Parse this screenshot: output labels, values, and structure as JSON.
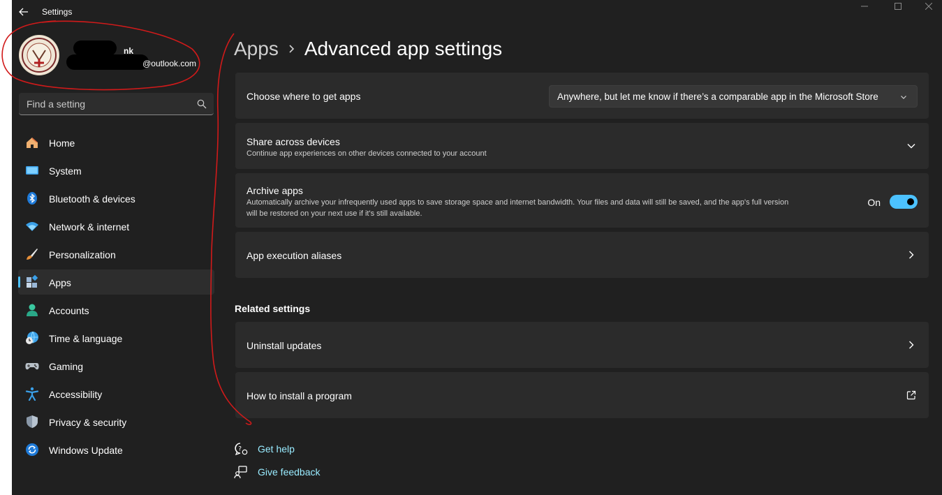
{
  "window": {
    "title": "Settings"
  },
  "profile": {
    "name_fragment": "nk",
    "email_fragment": "@outlook.com"
  },
  "search": {
    "placeholder": "Find a setting"
  },
  "sidebar": {
    "items": [
      {
        "label": "Home",
        "icon": "home-icon"
      },
      {
        "label": "System",
        "icon": "system-icon"
      },
      {
        "label": "Bluetooth & devices",
        "icon": "bluetooth-icon"
      },
      {
        "label": "Network & internet",
        "icon": "wifi-icon"
      },
      {
        "label": "Personalization",
        "icon": "brush-icon"
      },
      {
        "label": "Apps",
        "icon": "apps-icon",
        "selected": true
      },
      {
        "label": "Accounts",
        "icon": "person-icon"
      },
      {
        "label": "Time & language",
        "icon": "globe-clock-icon"
      },
      {
        "label": "Gaming",
        "icon": "gamepad-icon"
      },
      {
        "label": "Accessibility",
        "icon": "accessibility-icon"
      },
      {
        "label": "Privacy & security",
        "icon": "shield-icon"
      },
      {
        "label": "Windows Update",
        "icon": "update-icon"
      }
    ]
  },
  "breadcrumb": {
    "parent": "Apps",
    "current": "Advanced app settings"
  },
  "settings": {
    "choose_apps": {
      "title": "Choose where to get apps",
      "value": "Anywhere, but let me know if there’s a comparable app in the Microsoft Store"
    },
    "share": {
      "title": "Share across devices",
      "description": "Continue app experiences on other devices connected to your account"
    },
    "archive": {
      "title": "Archive apps",
      "description_line1": "Automatically archive your infrequently used apps to save storage space and internet bandwidth. Your files and data will still be saved, and the app's full version",
      "description_line2": "will be restored on your next use if it's still available.",
      "state_label": "On",
      "enabled": true
    },
    "aliases": {
      "title": "App execution aliases"
    }
  },
  "related": {
    "heading": "Related settings",
    "uninstall": "Uninstall updates",
    "install": "How to install a program"
  },
  "help": {
    "get_help": "Get help",
    "feedback": "Give feedback"
  },
  "colors": {
    "accent": "#4cc2ff",
    "link": "#99ebff",
    "window_bg": "#202020",
    "card_bg": "#2b2b2b",
    "annotation": "#d11a1a"
  }
}
